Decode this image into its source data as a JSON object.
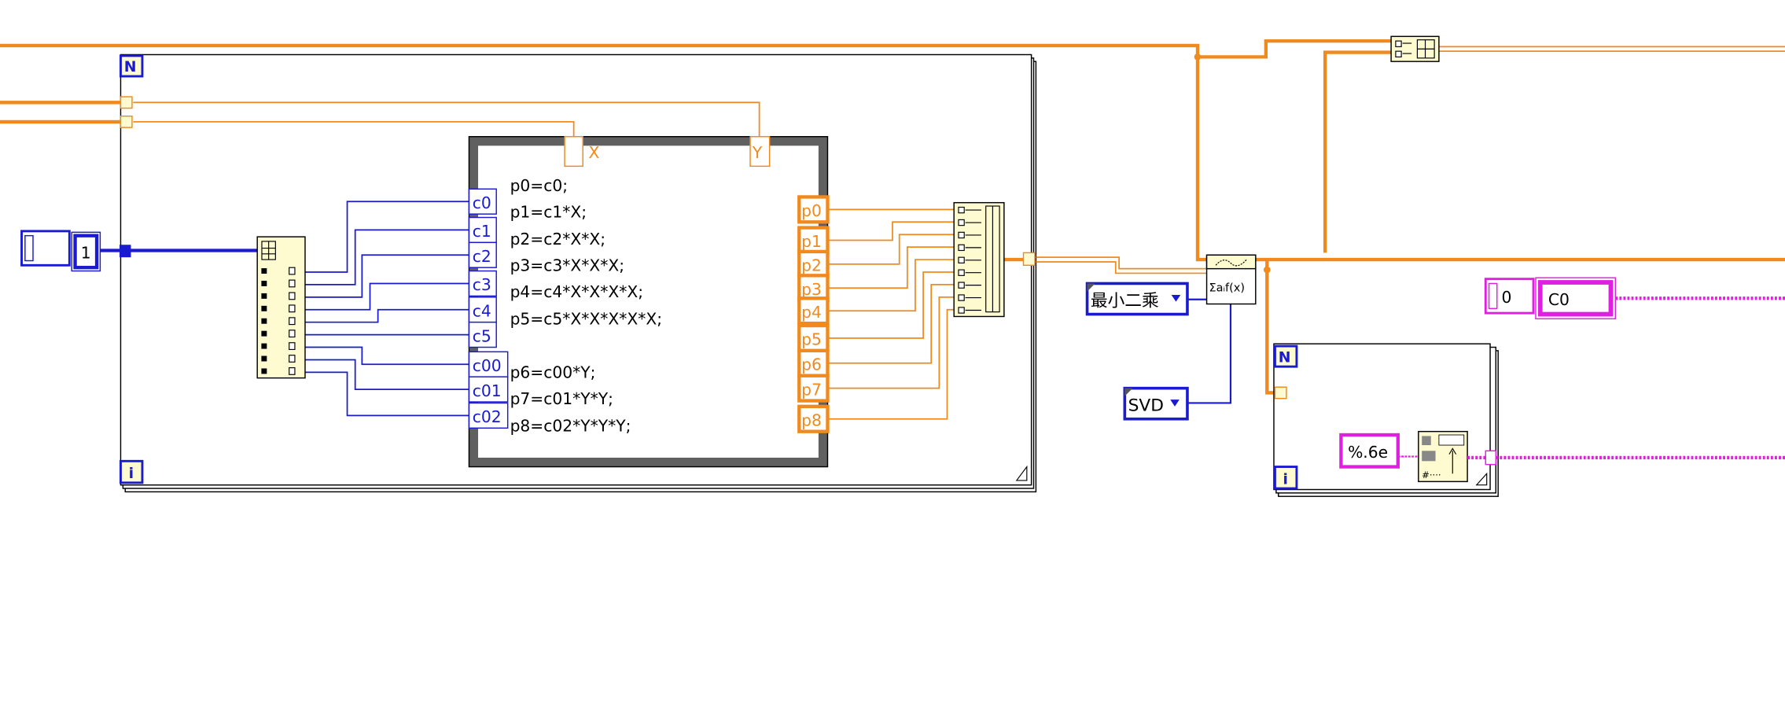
{
  "colors": {
    "orange_wire": "#f08a1c",
    "blue_wire": "#1a1ad0",
    "magenta_wire": "#e020e0",
    "node_fill": "#fffbd0",
    "frame_gray": "#606060"
  },
  "for_loop_main": {
    "count_label": "N",
    "index_label": "i"
  },
  "index_constant": {
    "value": "0",
    "element": "1"
  },
  "formula_node": {
    "inputs_top": [
      "X",
      "Y"
    ],
    "inputs_left": [
      "c0",
      "c1",
      "c2",
      "c3",
      "c4",
      "c5",
      "c00",
      "c01",
      "c02"
    ],
    "outputs": [
      "p0",
      "p1",
      "p2",
      "p3",
      "p4",
      "p5",
      "p6",
      "p7",
      "p8"
    ],
    "code": [
      "p0=c0;",
      "p1=c1*X;",
      "p2=c2*X*X;",
      "p3=c3*X*X*X;",
      "p4=c4*X*X*X*X;",
      "p5=c5*X*X*X*X*X;",
      "p6=c00*Y;",
      "p7=c01*Y*Y;",
      "p8=c02*Y*Y*Y;"
    ]
  },
  "fit_node": {
    "icon": "general-ls-linear-fit-icon",
    "label": "Σaᵢf(x)"
  },
  "method_ring": {
    "value": "最小二乘"
  },
  "algorithm_ring": {
    "value": "SVD"
  },
  "string_array_constant": {
    "index": "0",
    "element": "C0"
  },
  "for_loop_small": {
    "count_label": "N",
    "index_label": "i",
    "format_string": "%.6e"
  }
}
